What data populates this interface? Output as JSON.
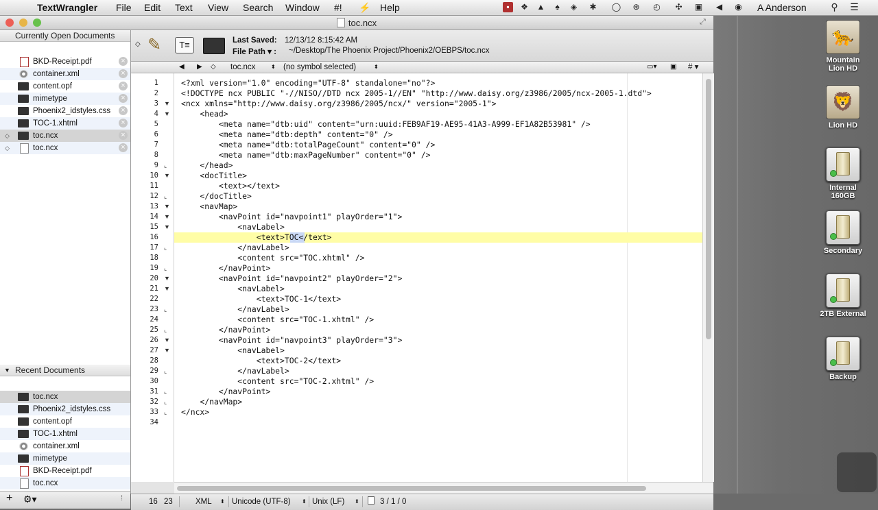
{
  "menubar": {
    "app": "TextWrangler",
    "menus": [
      "File",
      "Edit",
      "Text",
      "View",
      "Search",
      "Window",
      "#!",
      "Help"
    ],
    "user": "A Anderson"
  },
  "window": {
    "title": "toc.ncx",
    "last_saved_label": "Last Saved:",
    "last_saved_value": "12/13/12 8:15:42 AM",
    "file_path_label": "File Path ▾ :",
    "file_path_value": "~/Desktop/The Phoenix Project/Phoenix2/OEBPS/toc.ncx"
  },
  "sidebar": {
    "open_header": "Currently Open Documents",
    "open_docs": [
      {
        "name": "BKD-Receipt.pdf",
        "icon": "pdf-icon"
      },
      {
        "name": "container.xml",
        "icon": "gear-icon"
      },
      {
        "name": "content.opf",
        "icon": "document-icon"
      },
      {
        "name": "mimetype",
        "icon": "document-icon"
      },
      {
        "name": "Phoenix2_idstyles.css",
        "icon": "document-icon"
      },
      {
        "name": "TOC-1.xhtml",
        "icon": "document-icon"
      },
      {
        "name": "toc.ncx",
        "icon": "document-icon"
      },
      {
        "name": "toc.ncx",
        "icon": "blank-document-icon"
      }
    ],
    "recent_header": "Recent Documents",
    "recent_docs": [
      {
        "name": "toc.ncx",
        "icon": "document-icon"
      },
      {
        "name": "Phoenix2_idstyles.css",
        "icon": "document-icon"
      },
      {
        "name": "content.opf",
        "icon": "document-icon"
      },
      {
        "name": "TOC-1.xhtml",
        "icon": "document-icon"
      },
      {
        "name": "container.xml",
        "icon": "gear-icon"
      },
      {
        "name": "mimetype",
        "icon": "document-icon"
      },
      {
        "name": "BKD-Receipt.pdf",
        "icon": "pdf-icon"
      },
      {
        "name": "toc.ncx",
        "icon": "blank-document-icon"
      }
    ]
  },
  "navbar": {
    "file_popup": "toc.ncx",
    "symbol_popup": "(no symbol selected)",
    "hash": "#"
  },
  "editor": {
    "current_line": 16,
    "lines": [
      "<?xml version=\"1.0\" encoding=\"UTF-8\" standalone=\"no\"?>",
      "<!DOCTYPE ncx PUBLIC \"-//NISO//DTD ncx 2005-1//EN\" \"http://www.daisy.org/z3986/2005/ncx-2005-1.dtd\">",
      "<ncx xmlns=\"http://www.daisy.org/z3986/2005/ncx/\" version=\"2005-1\">",
      "    <head>",
      "        <meta name=\"dtb:uid\" content=\"urn:uuid:FEB9AF19-AE95-41A3-A999-EF1A82B53981\" />",
      "        <meta name=\"dtb:depth\" content=\"0\" />",
      "        <meta name=\"dtb:totalPageCount\" content=\"0\" />",
      "        <meta name=\"dtb:maxPageNumber\" content=\"0\" />",
      "    </head>",
      "    <docTitle>",
      "        <text></text>",
      "    </docTitle>",
      "    <navMap>",
      "        <navPoint id=\"navpoint1\" playOrder=\"1\">",
      "            <navLabel>",
      "                <text>TOC</text>",
      "            </navLabel>",
      "            <content src=\"TOC.xhtml\" />",
      "        </navPoint>",
      "        <navPoint id=\"navpoint2\" playOrder=\"2\">",
      "            <navLabel>",
      "                <text>TOC-1</text>",
      "            </navLabel>",
      "            <content src=\"TOC-1.xhtml\" />",
      "        </navPoint>",
      "        <navPoint id=\"navpoint3\" playOrder=\"3\">",
      "            <navLabel>",
      "                <text>TOC-2</text>",
      "            </navLabel>",
      "            <content src=\"TOC-2.xhtml\" />",
      "        </navPoint>",
      "    </navMap>",
      "</ncx>",
      ""
    ],
    "fold_markers": [
      "",
      "",
      "open",
      "open",
      "",
      "",
      "",
      "",
      "close",
      "open",
      "",
      "close",
      "open",
      "open",
      "open",
      "",
      "close",
      "",
      "close",
      "open",
      "open",
      "",
      "close",
      "",
      "close",
      "open",
      "open",
      "",
      "close",
      "",
      "close",
      "close",
      "close",
      ""
    ]
  },
  "status": {
    "line": "16",
    "column": "23",
    "language": "XML",
    "encoding": "Unicode (UTF-8)",
    "line_endings": "Unix (LF)",
    "stats": "3 / 1 / 0"
  },
  "desktop": {
    "icons": [
      {
        "label_1": "Mountain",
        "label_2": "Lion HD",
        "kind": "cat"
      },
      {
        "label_1": "Lion HD",
        "label_2": "",
        "kind": "cat"
      },
      {
        "label_1": "Internal",
        "label_2": "160GB",
        "kind": "drive"
      },
      {
        "label_1": "Secondary",
        "label_2": "",
        "kind": "drive"
      },
      {
        "label_1": "2TB External",
        "label_2": "",
        "kind": "drive"
      },
      {
        "label_1": "Backup",
        "label_2": "",
        "kind": "drive"
      }
    ]
  },
  "colors": {
    "current_line_highlight": "#fffda6",
    "selection": "#c9d8f5",
    "close_light": "#ec5f56",
    "minimize_light": "#e7b548",
    "zoom_light": "#68c14b"
  }
}
